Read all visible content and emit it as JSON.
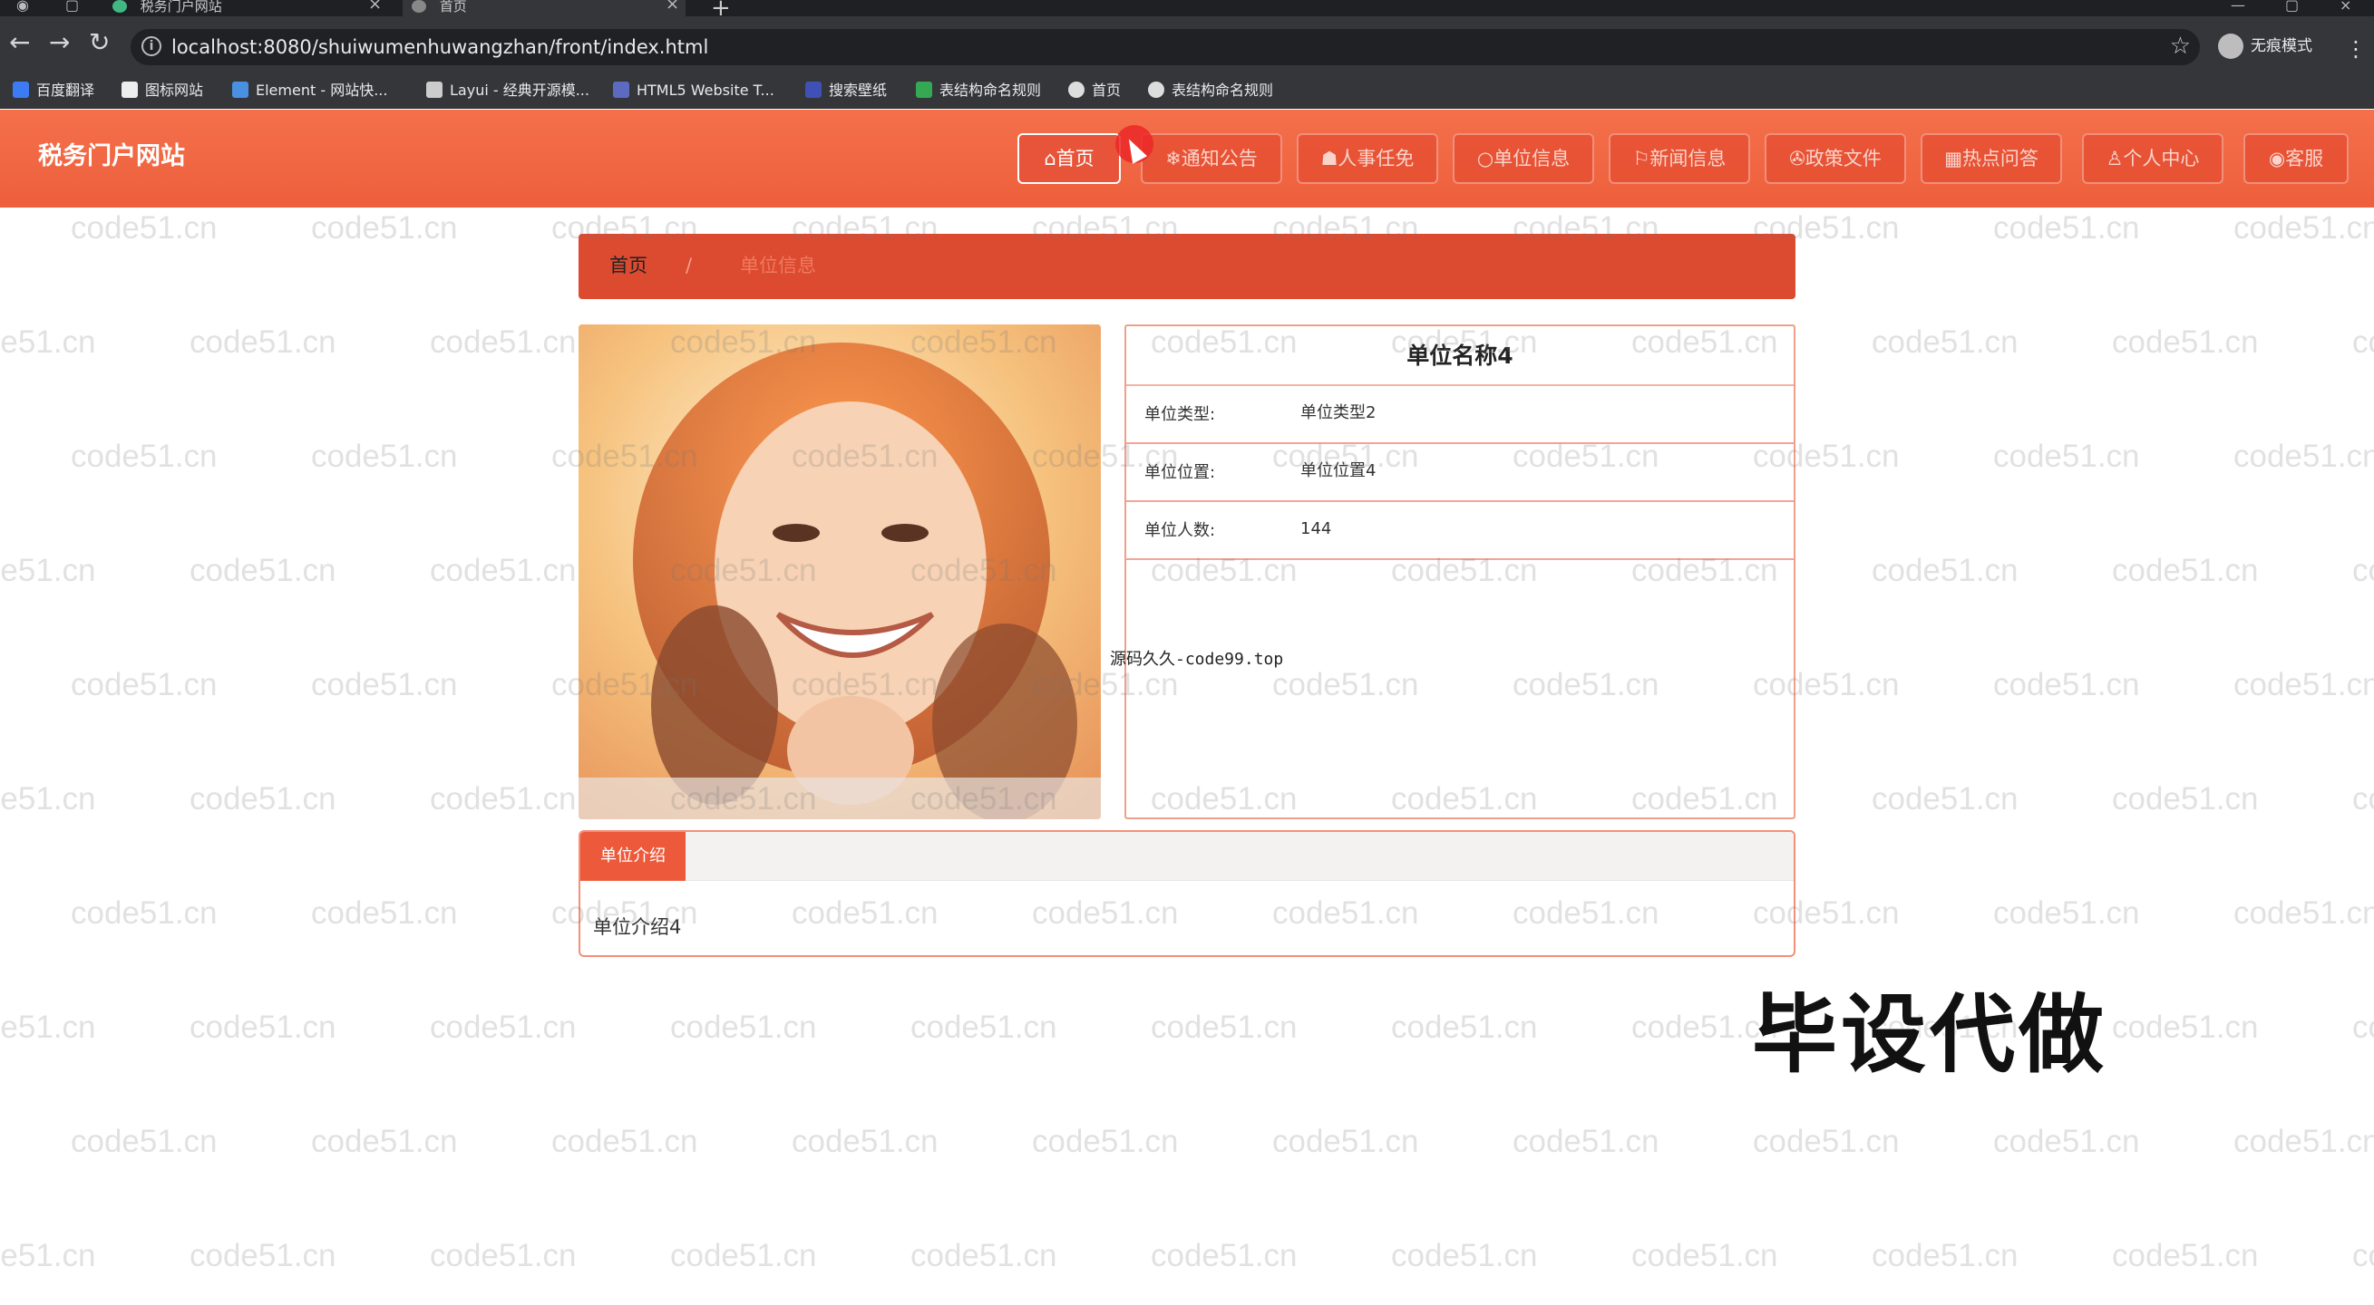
{
  "browser": {
    "tabs": [
      {
        "label": "税务门户网站",
        "active": false
      },
      {
        "label": "首页",
        "active": true
      }
    ],
    "url": "localhost:8080/shuiwumenhuwangzhan/front/index.html",
    "incognito_label": "无痕模式",
    "bookmarks": [
      {
        "label": "百度翻译",
        "color": "#3b7cf5"
      },
      {
        "label": "图标网站",
        "color": "#eeeeee"
      },
      {
        "label": "Element - 网站快...",
        "color": "#4a90e2"
      },
      {
        "label": "Layui - 经典开源模...",
        "color": "#cccccc"
      },
      {
        "label": "HTML5 Website T...",
        "color": "#5c6bc0"
      },
      {
        "label": "搜索壁纸",
        "color": "#3f51b5"
      },
      {
        "label": "表结构命名规则",
        "color": "#34a853"
      },
      {
        "label": "首页",
        "color": "#dddddd"
      },
      {
        "label": "表结构命名规则",
        "color": "#dddddd"
      }
    ]
  },
  "site": {
    "title": "税务门户网站",
    "nav": [
      {
        "label": "⌂首页",
        "active": true
      },
      {
        "label": "❄通知公告",
        "active": false
      },
      {
        "label": "☗人事任免",
        "active": false
      },
      {
        "label": "○单位信息",
        "active": false
      },
      {
        "label": "⚐新闻信息",
        "active": false
      },
      {
        "label": "✇政策文件",
        "active": false
      },
      {
        "label": "▦热点问答",
        "active": false
      },
      {
        "label": "♙个人中心",
        "active": false
      },
      {
        "label": "◉客服",
        "active": false
      }
    ]
  },
  "breadcrumb": {
    "home": "首页",
    "separator": "/",
    "current": "单位信息"
  },
  "detail": {
    "name": "单位名称4",
    "rows": [
      {
        "label": "单位类型:",
        "value": "单位类型2"
      },
      {
        "label": "单位位置:",
        "value": "单位位置4"
      },
      {
        "label": "单位人数:",
        "value": "144"
      }
    ]
  },
  "overlay_text": "源码久久-code99.top",
  "intro": {
    "tab_label": "单位介绍",
    "content": "单位介绍4"
  },
  "watermark": "code51.cn",
  "stamp": "毕设代做",
  "colors": {
    "header": "#ee5f3c",
    "breadcrumb": "#dc4a30",
    "accent": "#ec5a3b"
  }
}
